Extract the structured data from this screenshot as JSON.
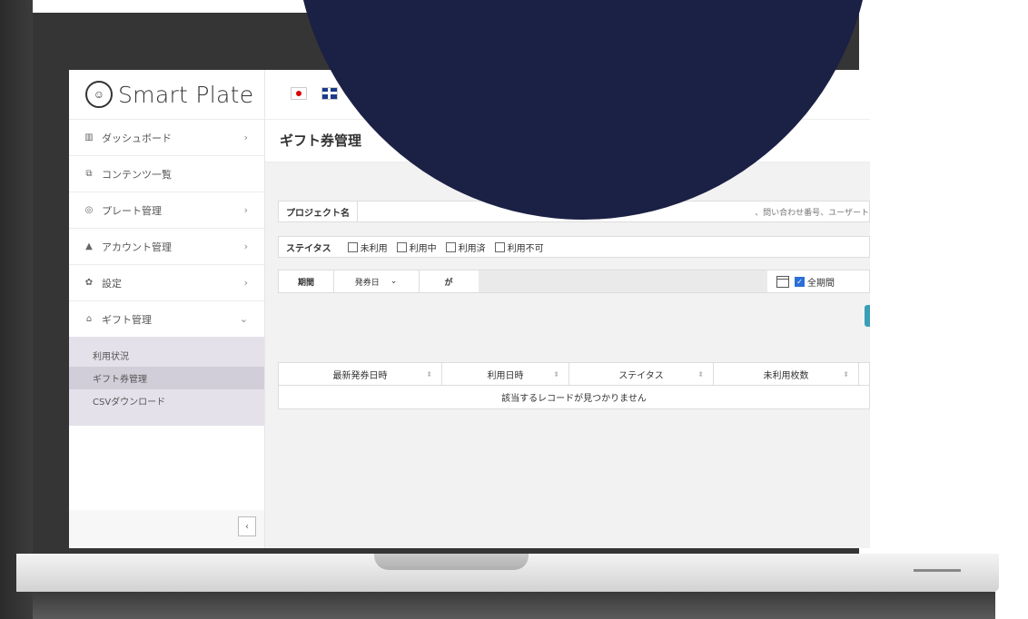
{
  "app": {
    "logo_text": "Smart Plate"
  },
  "sidebar": {
    "items": [
      {
        "label": "ダッシュボード",
        "icon": "bar-chart-icon",
        "chevron": "›"
      },
      {
        "label": "コンテンツ一覧",
        "icon": "content-icon",
        "chevron": ""
      },
      {
        "label": "プレート管理",
        "icon": "plate-icon",
        "chevron": "›"
      },
      {
        "label": "アカウント管理",
        "icon": "user-icon",
        "chevron": "›"
      },
      {
        "label": "設定",
        "icon": "gear-icon",
        "chevron": "›"
      },
      {
        "label": "ギフト管理",
        "icon": "home-icon",
        "chevron": "⌄"
      }
    ],
    "submenu": [
      {
        "label": "利用状況"
      },
      {
        "label": "ギフト券管理"
      },
      {
        "label": "CSVダウンロード"
      }
    ],
    "collapse_label": "‹"
  },
  "header": {
    "languages": [
      "jp-flag",
      "uk-flag"
    ]
  },
  "page": {
    "title": "ギフト券管理"
  },
  "filters": {
    "project_label": "プロジェクト名",
    "project_hint": "、問い合わせ番号、ユーザート",
    "status_label": "ステイタス",
    "status_options": [
      "未利用",
      "利用中",
      "利用済",
      "利用不可"
    ],
    "period_label": "期間",
    "period_select": "発券日",
    "period_ga": "が",
    "all_period_label": "全期間"
  },
  "table": {
    "columns": [
      "最新発券日時",
      "利用日時",
      "ステイタス",
      "未利用枚数"
    ],
    "empty_message": "該当するレコードが見つかりません"
  },
  "colors": {
    "overlay_navy": "#1b2045",
    "submenu_bg": "#e4e1ea",
    "accent_teal": "#3a9eb7",
    "checkbox_blue": "#2b6fd6"
  }
}
